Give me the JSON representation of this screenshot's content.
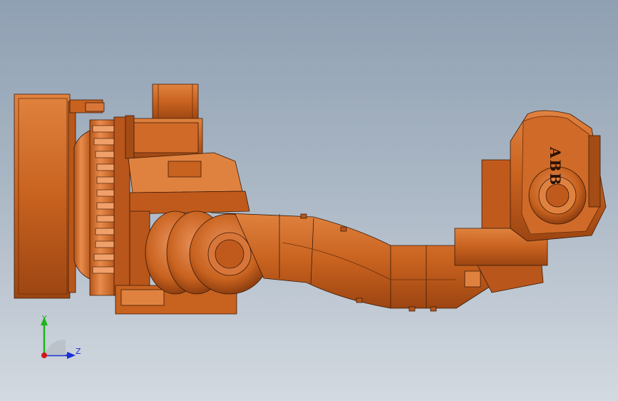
{
  "viewport": {
    "background_top": "#8fa0b2",
    "background_bottom": "#d3d9e0"
  },
  "model": {
    "brand_label": "ABB",
    "body_color": "#c8621f",
    "highlight_color": "#e58a4a",
    "shadow_color": "#8a3c10",
    "edge_color": "#3a1a08"
  },
  "triad": {
    "y_label": "Y",
    "z_label": "Z",
    "y_color": "#1db31d",
    "z_color": "#1a2fd6",
    "x_color": "#d01818"
  }
}
